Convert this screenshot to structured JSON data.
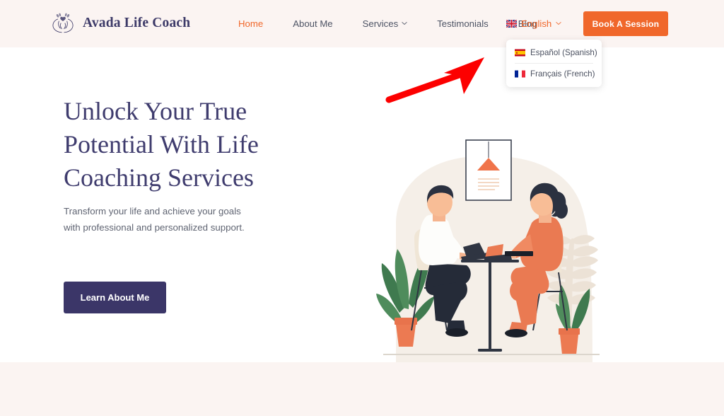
{
  "header": {
    "brand": {
      "name": "Avada Life Coach",
      "icon": "hands-heart-logo-icon"
    },
    "nav": [
      {
        "label": "Home",
        "active": true,
        "caret": false
      },
      {
        "label": "About Me",
        "active": false,
        "caret": false
      },
      {
        "label": "Services",
        "active": false,
        "caret": true
      },
      {
        "label": "Testimonials",
        "active": false,
        "caret": false
      },
      {
        "label": "Blog",
        "active": false,
        "caret": false
      }
    ],
    "language_switcher": {
      "current": "English",
      "flag": "uk-flag-icon",
      "caret": "chevron-down-icon",
      "expanded": true,
      "options": [
        {
          "label": "Español (Spanish)",
          "flag": "spain-flag-icon"
        },
        {
          "label": "Français (French)",
          "flag": "france-flag-icon"
        }
      ]
    },
    "cta_label": "Book A Session"
  },
  "hero": {
    "title": "Unlock Your True Potential With Life Coaching Services",
    "subtitle": "Transform your life and achieve your goals with professional and personalized support.",
    "button_label": "Learn About Me",
    "illustration": "two-people-coaching-session-illustration"
  },
  "annotation": {
    "type": "red-arrow",
    "points_to": "language-dropdown"
  },
  "colors": {
    "accent_orange": "#f0672b",
    "navy": "#3b3668",
    "heading_navy": "#3f3c6e",
    "header_bg": "#fbf4f2",
    "body_text": "#5f6472",
    "nav_text": "#4d5364",
    "annotation_red": "#fc0000",
    "page_bg": "#ffffff"
  }
}
